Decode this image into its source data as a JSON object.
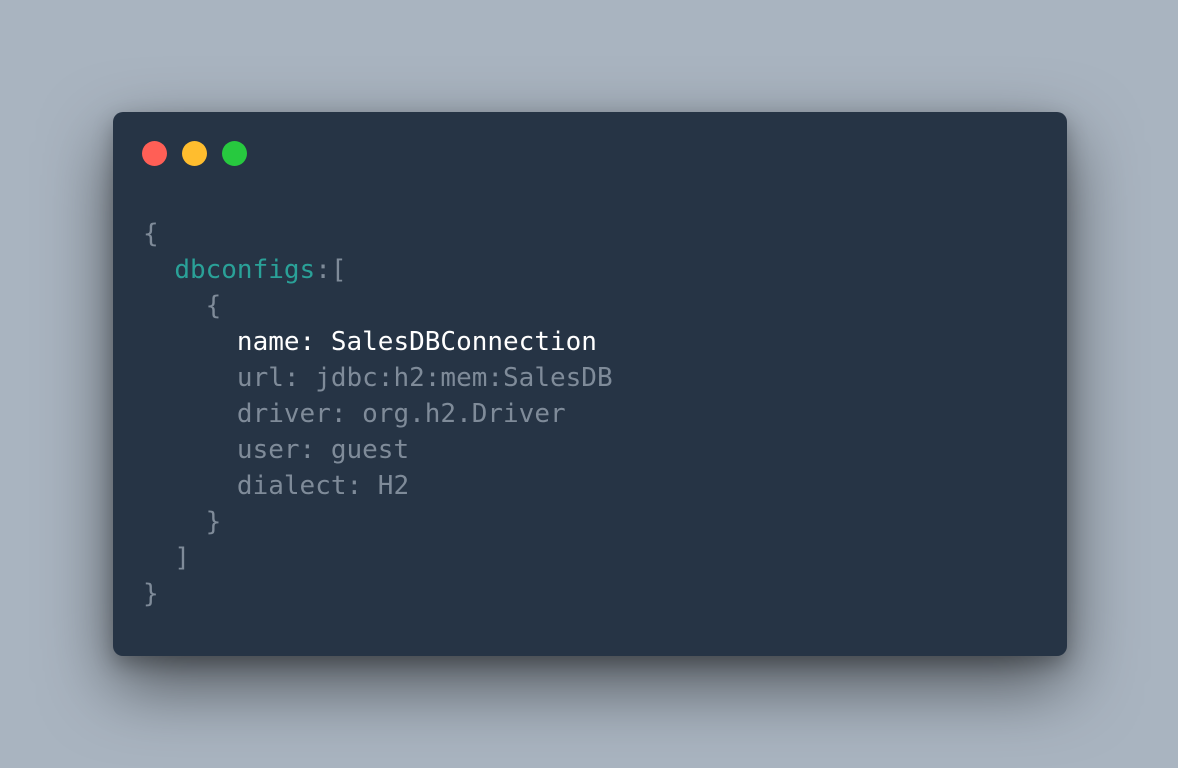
{
  "window": {
    "controls": {
      "close_color": "#ff5f56",
      "minimize_color": "#ffbd2e",
      "maximize_color": "#27c93f"
    }
  },
  "code": {
    "open_brace": "{",
    "dbconfigs_key": "dbconfigs",
    "dbconfigs_punct": ":[",
    "inner_open": "{",
    "name_line": "name: SalesDBConnection",
    "url_line": "url: jdbc:h2:mem:SalesDB",
    "driver_line": "driver: org.h2.Driver",
    "user_line": "user: guest",
    "dialect_line": "dialect: H2",
    "inner_close": "}",
    "array_close": "]",
    "close_brace": "}"
  },
  "colors": {
    "background": "#a9b4c0",
    "window": "#263445",
    "text_dim": "#7f8b99",
    "key_teal": "#2aa198",
    "highlight": "#ffffff"
  }
}
